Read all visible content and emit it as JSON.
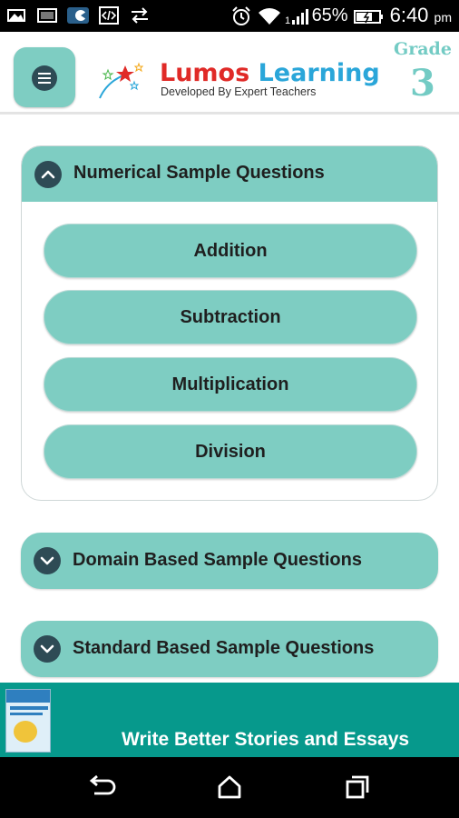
{
  "status_bar": {
    "battery_percent": "65%",
    "time": "6:40",
    "ampm": "pm",
    "icons": [
      "gallery-icon",
      "image-icon",
      "whatsapp-icon",
      "code-icon",
      "sync-icon",
      "alarm-icon",
      "wifi-icon",
      "signal-icon",
      "battery-icon"
    ]
  },
  "header": {
    "menu_icon": "hamburger-menu-icon",
    "logo_part1": "Lumos",
    "logo_part2": "Learning",
    "tagline": "Developed By Expert Teachers",
    "grade_label": "Grade",
    "grade_value": "3"
  },
  "sections": [
    {
      "title": "Numerical Sample Questions",
      "expanded": true,
      "icon": "chevron-up-icon",
      "items": [
        "Addition",
        "Subtraction",
        "Multiplication",
        "Division"
      ]
    },
    {
      "title": "Domain Based Sample Questions",
      "expanded": false,
      "icon": "chevron-down-icon"
    },
    {
      "title": "Standard Based Sample Questions",
      "expanded": false,
      "icon": "chevron-down-icon"
    }
  ],
  "ad": {
    "text": "Write Better Stories and Essays",
    "book_cover_title": "Write Better Stories and Essays"
  },
  "nav_bar": {
    "back_icon": "back-icon",
    "home_icon": "home-icon",
    "recents_icon": "recents-icon"
  },
  "colors": {
    "accent": "#7ecdc2",
    "icon_dark": "#2e4b55",
    "ad_bg": "#06998c",
    "logo_red": "#e02a27",
    "logo_blue": "#2aa6d9"
  }
}
